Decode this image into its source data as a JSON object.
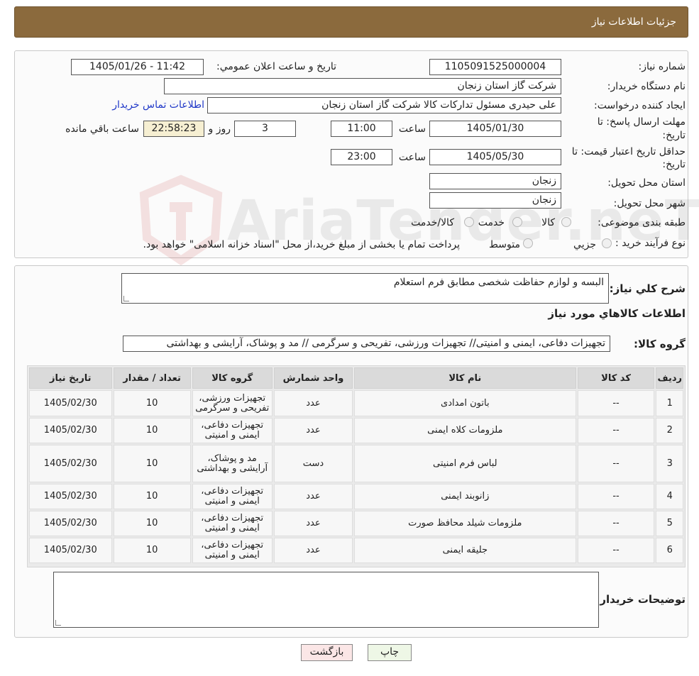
{
  "header": {
    "title": "جزئیات اطلاعات نیاز"
  },
  "watermark": {
    "text": "AriaTender.neT"
  },
  "details": {
    "need_number_label": "شماره نیاز:",
    "need_number": "1105091525000004",
    "announce_label": "تاریخ و ساعت اعلان عمومي:",
    "announce_value": "1405/01/26 - 11:42",
    "buyer_org_label": "نام دستگاه خریدار:",
    "buyer_org": "شرکت گاز استان زنجان",
    "creator_label": "ایجاد کننده درخواست:",
    "creator": "علی حیدری مسئول تداركات كالا شرکت گاز استان زنجان",
    "contact_link": "اطلاعات تماس خریدار",
    "deadline_label_1": "مهلت ارسال پاسخ: تا",
    "deadline_label_2": "تاریخ:",
    "deadline_date": "1405/01/30",
    "time_label": "ساعت",
    "deadline_time": "11:00",
    "days_value": "3",
    "days_label": "روز و",
    "remaining_value": "22:58:23",
    "remaining_label": "ساعت باقي مانده",
    "validity_label_1": "حداقل تاریخ اعتبار قیمت: تا",
    "validity_label_2": "تاریخ:",
    "validity_date": "1405/05/30",
    "validity_time": "23:00",
    "province_label": "استان محل تحویل:",
    "province": "زنجان",
    "city_label": "شهر محل تحویل:",
    "city": "زنجان",
    "category_label": "طبقه بندی موضوعی:",
    "category_options": [
      "کالا",
      "خدمت",
      "کالا/خدمت"
    ],
    "process_label": "نوع فرآیند خرید :",
    "process_options": [
      "جزیي",
      "متوسط"
    ],
    "payment_note": "پرداخت تمام یا بخشی از مبلغ خرید،از محل \"اسناد خزانه اسلامی\" خواهد بود."
  },
  "description": {
    "label": "شرح کلي نياز:",
    "value": "البسه و لوازم حفاظت شخصی مطابق فرم استعلام"
  },
  "goods": {
    "section_title": "اطلاعات کالاهاي مورد نياز",
    "group_label": "گروه کالا:",
    "group_value": "تجهیزات دفاعی، ایمنی و امنیتی// تجهیزات ورزشی، تفریحی و سرگرمی // مد و پوشاک، آرایشی و بهداشتی",
    "headers": [
      "رديف",
      "کد کالا",
      "نام کالا",
      "واحد شمارش",
      "گروه کالا",
      "تعداد / مقدار",
      "تاریخ نیاز"
    ],
    "rows": [
      {
        "row": "1",
        "code": "--",
        "name": "باتون امدادی",
        "unit": "عدد",
        "group": "تجهیزات ورزشی، تفریحی و سرگرمی",
        "qty": "10",
        "date": "1405/02/30"
      },
      {
        "row": "2",
        "code": "--",
        "name": "ملزومات کلاه ایمنی",
        "unit": "عدد",
        "group": "تجهیزات دفاعی، ایمنی و امنیتی",
        "qty": "10",
        "date": "1405/02/30"
      },
      {
        "row": "3",
        "code": "--",
        "name": "لباس فرم امنیتی",
        "unit": "دست",
        "group": "مد و پوشاک، آرایشی و بهداشتی",
        "qty": "10",
        "date": "1405/02/30"
      },
      {
        "row": "4",
        "code": "--",
        "name": "زانوبند ایمنی",
        "unit": "عدد",
        "group": "تجهیزات دفاعی، ایمنی و امنیتی",
        "qty": "10",
        "date": "1405/02/30"
      },
      {
        "row": "5",
        "code": "--",
        "name": "ملزومات شیلد محافظ صورت",
        "unit": "عدد",
        "group": "تجهیزات دفاعی، ایمنی و امنیتی",
        "qty": "10",
        "date": "1405/02/30"
      },
      {
        "row": "6",
        "code": "--",
        "name": "جلیقه ایمنی",
        "unit": "عدد",
        "group": "تجهیزات دفاعی، ایمنی و امنیتی",
        "qty": "10",
        "date": "1405/02/30"
      }
    ]
  },
  "buyer_notes": {
    "label": "توضیحات خریدار:",
    "value": ""
  },
  "buttons": {
    "print": "چاپ",
    "back": "بازگشت"
  }
}
